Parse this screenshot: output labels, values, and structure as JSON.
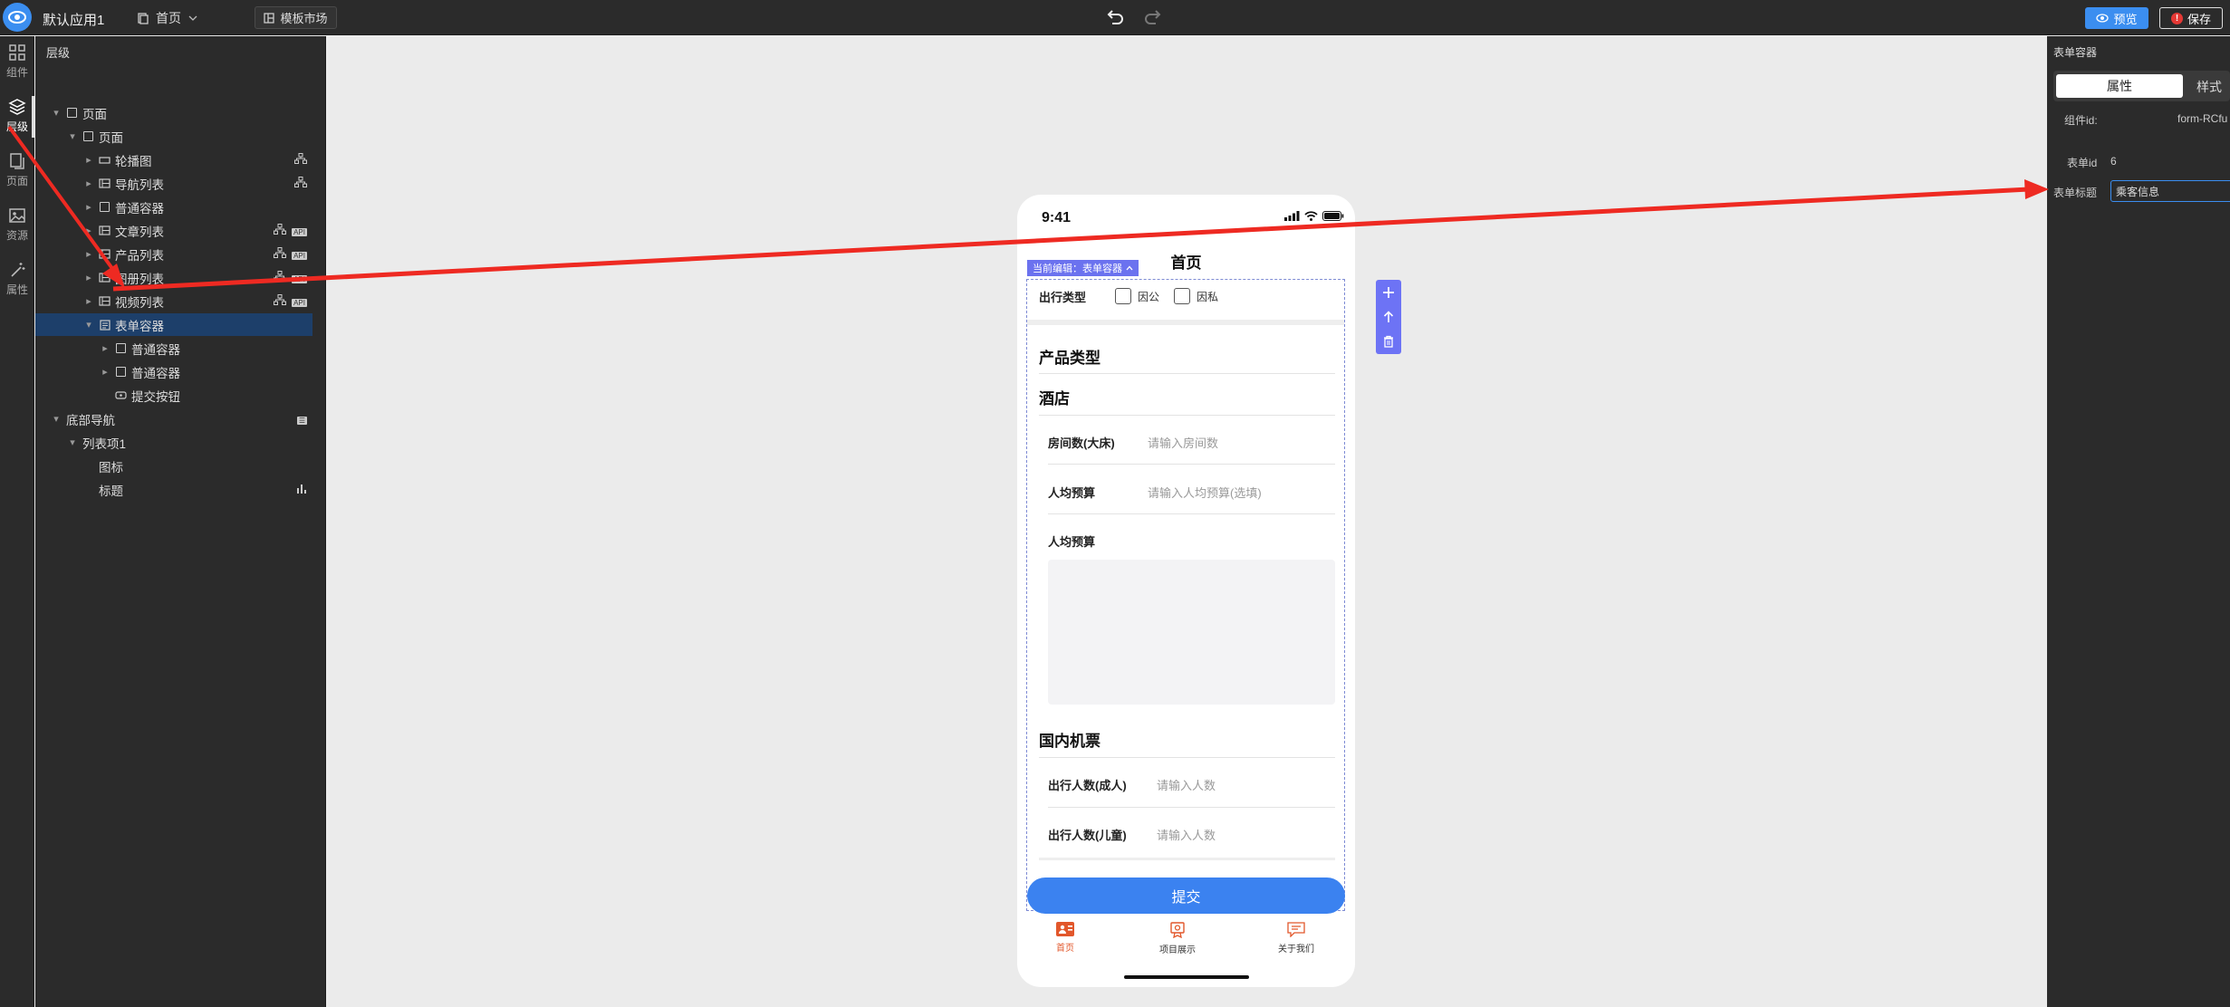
{
  "topbar": {
    "app_name": "默认应用1",
    "page_selector": "首页",
    "template_market": "模板市场",
    "preview": "预览",
    "save": "保存"
  },
  "rail": {
    "items": [
      {
        "label": "组件",
        "icon": "grid-icon"
      },
      {
        "label": "层级",
        "icon": "layers-icon",
        "active": true
      },
      {
        "label": "页面",
        "icon": "pages-icon"
      },
      {
        "label": "资源",
        "icon": "image-icon"
      },
      {
        "label": "属性",
        "icon": "magic-wand-icon"
      }
    ]
  },
  "tree": {
    "title": "层级",
    "nodes": [
      {
        "label": "页面",
        "depth": 0,
        "expanded": true,
        "icon": "box-icon"
      },
      {
        "label": "页面",
        "depth": 1,
        "expanded": true,
        "icon": "box-icon"
      },
      {
        "label": "轮播图",
        "depth": 2,
        "expanded": false,
        "icon": "carousel-icon",
        "tail": [
          "hierarchy-icon"
        ]
      },
      {
        "label": "导航列表",
        "depth": 2,
        "expanded": false,
        "icon": "list-icon",
        "tail": [
          "hierarchy-icon"
        ]
      },
      {
        "label": "普通容器",
        "depth": 2,
        "expanded": false,
        "icon": "box-icon"
      },
      {
        "label": "文章列表",
        "depth": 2,
        "expanded": false,
        "icon": "list-icon",
        "tail": [
          "hierarchy-icon",
          "api-icon"
        ]
      },
      {
        "label": "产品列表",
        "depth": 2,
        "expanded": false,
        "icon": "list-icon",
        "tail": [
          "hierarchy-icon",
          "api-icon"
        ]
      },
      {
        "label": "图册列表",
        "depth": 2,
        "expanded": false,
        "icon": "list-icon",
        "tail": [
          "hierarchy-icon",
          "api-icon"
        ]
      },
      {
        "label": "视频列表",
        "depth": 2,
        "expanded": false,
        "icon": "list-icon",
        "tail": [
          "hierarchy-icon",
          "api-icon"
        ]
      },
      {
        "label": "表单容器",
        "depth": 2,
        "expanded": true,
        "icon": "form-icon",
        "selected": true
      },
      {
        "label": "普通容器",
        "depth": 3,
        "expanded": false,
        "icon": "box-icon"
      },
      {
        "label": "普通容器",
        "depth": 3,
        "expanded": false,
        "icon": "box-icon"
      },
      {
        "label": "提交按钮",
        "depth": 3,
        "icon": "button-icon"
      },
      {
        "label": "底部导航",
        "depth": 0,
        "expanded": true,
        "tail": [
          "tag-icon"
        ]
      },
      {
        "label": "列表项1",
        "depth": 1,
        "expanded": true
      },
      {
        "label": "图标",
        "depth": 2
      },
      {
        "label": "标题",
        "depth": 2,
        "tail": [
          "bar-chart-icon"
        ]
      }
    ],
    "tail_api_text": "API"
  },
  "phone": {
    "time": "9:41",
    "page_title": "首页",
    "editing_tag": "当前编辑：表单容器",
    "travel_type": {
      "label": "出行类型",
      "options": [
        "因公",
        "因私"
      ]
    },
    "product_type": "产品类型",
    "hotel": {
      "title": "酒店",
      "rooms_label": "房间数(大床)",
      "rooms_placeholder": "请输入房间数",
      "budget_label": "人均预算",
      "budget_placeholder": "请输入人均预算(选填)",
      "budget2_label": "人均预算"
    },
    "flight": {
      "title": "国内机票",
      "adults_label": "出行人数(成人)",
      "adults_placeholder": "请输入人数",
      "kids_label": "出行人数(儿童)",
      "kids_placeholder": "请输入人数"
    },
    "submit": "提交",
    "tabs": [
      {
        "label": "首页",
        "icon": "home-badge-icon",
        "active": true
      },
      {
        "label": "项目展示",
        "icon": "award-icon"
      },
      {
        "label": "关于我们",
        "icon": "chat-icon"
      }
    ]
  },
  "props": {
    "title": "表单容器",
    "tab_attrs": "属性",
    "tab_style": "样式",
    "component_id_label": "组件id:",
    "component_id_value": "form-RCfu",
    "form_id_label": "表单id",
    "form_id_value": "6",
    "form_title_label": "表单标题",
    "form_title_value": "乘客信息"
  },
  "colors": {
    "accent": "#3b8ef0",
    "selection": "#1d3f6a",
    "editor_tag": "#6b72ef",
    "annotation_arrow": "#ee2a22"
  }
}
